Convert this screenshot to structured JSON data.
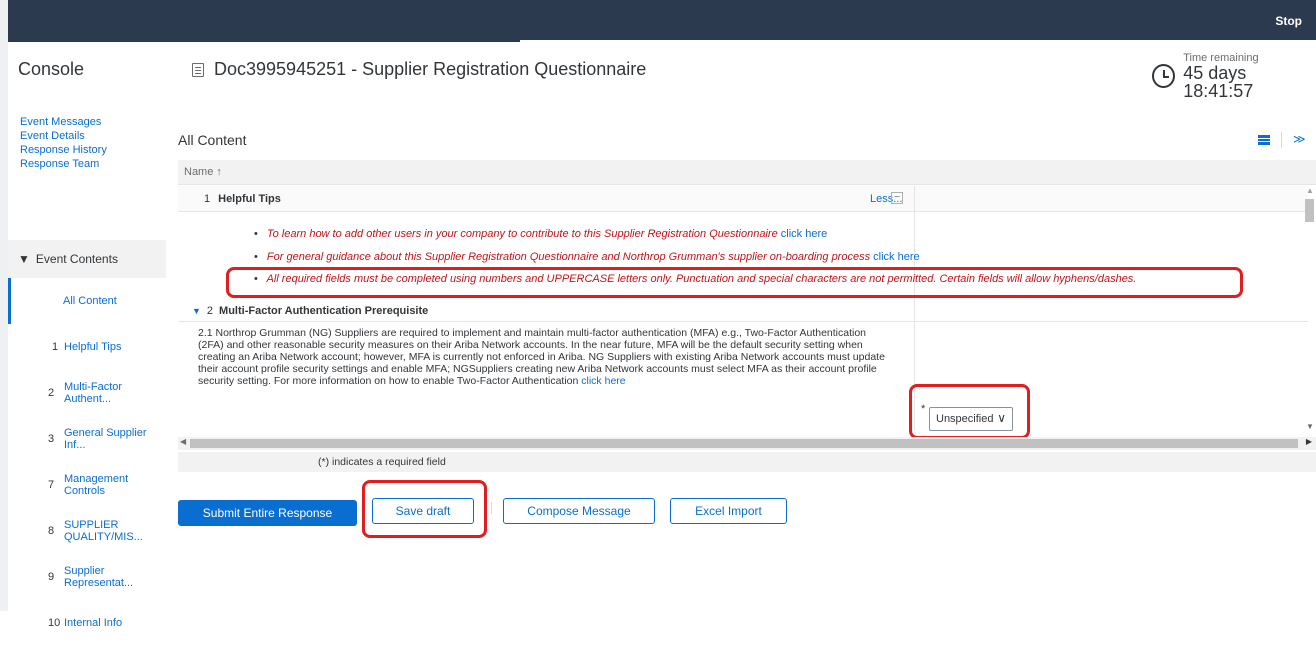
{
  "header": {
    "stop_label": "Stop",
    "console_label": "Console",
    "doc_title": "Doc3995945251 - Supplier Registration Questionnaire",
    "time_remaining_label": "Time remaining",
    "time_remaining_value": "45 days 18:41:57"
  },
  "sidebar": {
    "links": [
      "Event Messages",
      "Event Details",
      "Response History",
      "Response Team"
    ],
    "event_contents_label": "Event Contents",
    "items": [
      {
        "num": "",
        "label": "All Content"
      },
      {
        "num": "1",
        "label": "Helpful Tips"
      },
      {
        "num": "2",
        "label": "Multi-Factor Authent..."
      },
      {
        "num": "3",
        "label": "General Supplier Inf..."
      },
      {
        "num": "7",
        "label": "Management Controls"
      },
      {
        "num": "8",
        "label": "SUPPLIER QUALITY/MIS..."
      },
      {
        "num": "9",
        "label": "Supplier Representat..."
      },
      {
        "num": "10",
        "label": "Internal Info"
      }
    ]
  },
  "main": {
    "title": "All Content",
    "column_name": "Name ↑",
    "rows": {
      "tips": {
        "num": "1",
        "title": "Helpful Tips",
        "less_label": "Less...",
        "less_box": "−"
      },
      "tip_lines": [
        {
          "text": "To learn how to add other users in your company to contribute to this Supplier Registration Questionnaire",
          "link": "click here"
        },
        {
          "text": "For general guidance about this Supplier Registration Questionnaire and Northrop Grumman's supplier on-boarding process",
          "link": "click here"
        },
        {
          "text": "All required fields must  be completed using numbers and UPPERCASE letters only.  Punctuation and special characters are not permitted.  Certain fields will allow hyphens/dashes.",
          "link": ""
        }
      ],
      "mfa": {
        "num": "2",
        "title": "Multi-Factor Authentication Prerequisite",
        "text": "2.1  Northrop Grumman (NG) Suppliers are required to implement and maintain multi-factor authentication (MFA) e.g., Two-Factor Authentication (2FA) and other reasonable security measures on their Ariba Network accounts. In the near future, MFA will be the default security setting when creating an Ariba Network account; however, MFA is currently not enforced in Ariba. NG Suppliers with existing Ariba Network accounts must update their account profile security settings and enable MFA; NGSuppliers creating new Ariba Network accounts must select MFA as their account profile security setting. For more information on how to enable Two-Factor Authentication",
        "link": "click here",
        "required_mark": "*",
        "select_value": "Unspecified"
      }
    },
    "footer_note": "(*) indicates a required field"
  },
  "buttons": {
    "submit": "Submit Entire Response",
    "save_draft": "Save draft",
    "compose": "Compose Message",
    "excel_import": "Excel Import"
  },
  "colors": {
    "topbar": "#2b3a4e",
    "accent": "#0a6ed1",
    "highlight": "#e11d1d",
    "tip_text": "#c0141c"
  }
}
